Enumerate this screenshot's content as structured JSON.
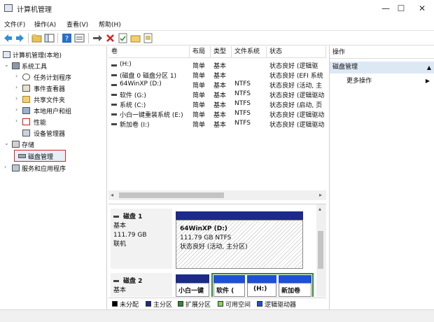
{
  "window": {
    "title": "计算机管理",
    "minimize_glyph": "—",
    "maximize_glyph": "☐",
    "close_glyph": "✕"
  },
  "menu": [
    "文件(F)",
    "操作(A)",
    "查看(V)",
    "帮助(H)"
  ],
  "tree": {
    "root": "计算机管理(本地)",
    "items": [
      {
        "label": "系统工具",
        "icon": "tools-icon"
      },
      {
        "label": "任务计划程序",
        "icon": "clock-icon"
      },
      {
        "label": "事件查看器",
        "icon": "event-viewer-icon"
      },
      {
        "label": "共享文件夹",
        "icon": "shared-folder-icon"
      },
      {
        "label": "本地用户和组",
        "icon": "users-icon"
      },
      {
        "label": "性能",
        "icon": "performance-icon"
      },
      {
        "label": "设备管理器",
        "icon": "device-manager-icon"
      },
      {
        "label": "存储",
        "icon": "storage-icon"
      },
      {
        "label": "磁盘管理",
        "icon": "disk-management-icon",
        "selected": true
      },
      {
        "label": "服务和应用程序",
        "icon": "services-icon"
      }
    ]
  },
  "volume_list": {
    "columns": [
      "卷",
      "布局",
      "类型",
      "文件系统",
      "状态"
    ],
    "rows": [
      {
        "volume": "(H:)",
        "layout": "简单",
        "type": "基本",
        "fs": "",
        "status": "状态良好 (逻辑驱"
      },
      {
        "volume": "(磁盘 0 磁盘分区 1)",
        "layout": "简单",
        "type": "基本",
        "fs": "",
        "status": "状态良好 (EFI 系统"
      },
      {
        "volume": "64WinXP  (D:)",
        "layout": "简单",
        "type": "基本",
        "fs": "NTFS",
        "status": "状态良好 (活动, 主"
      },
      {
        "volume": "软件 (G:)",
        "layout": "简单",
        "type": "基本",
        "fs": "NTFS",
        "status": "状态良好 (逻辑驱动"
      },
      {
        "volume": "系统 (C:)",
        "layout": "简单",
        "type": "基本",
        "fs": "NTFS",
        "status": "状态良好 (启动, 页"
      },
      {
        "volume": "小白一键重装系统 (E:)",
        "layout": "简单",
        "type": "基本",
        "fs": "NTFS",
        "status": "状态良好 (逻辑驱动"
      },
      {
        "volume": "新加卷 (I:)",
        "layout": "简单",
        "type": "基本",
        "fs": "NTFS",
        "status": "状态良好 (逻辑驱动"
      }
    ]
  },
  "disks": [
    {
      "name": "磁盘 1",
      "kind": "基本",
      "size": "111.79 GB",
      "state": "联机",
      "partition": {
        "name": "64WinXP   (D:)",
        "size": "111.79 GB NTFS",
        "status": "状态良好 (活动, 主分区)"
      }
    },
    {
      "name": "磁盘 2",
      "kind": "基本",
      "partitions": [
        "小白一键",
        "软件  (",
        "(H:)",
        "新加卷"
      ]
    }
  ],
  "legend": [
    {
      "label": "未分配",
      "color": "#000000"
    },
    {
      "label": "主分区",
      "color": "#1c2a8a"
    },
    {
      "label": "扩展分区",
      "color": "#2e8b2e"
    },
    {
      "label": "可用空间",
      "color": "#7cd850"
    },
    {
      "label": "逻辑驱动器",
      "color": "#1e4fd8"
    }
  ],
  "actions": {
    "header": "操作",
    "section": "磁盘管理",
    "more": "更多操作"
  },
  "colors": {
    "selected_outline": "#e02020",
    "primary_partition": "#1c2a8a",
    "logical_drive": "#1e4fd8",
    "extended_partition": "#2e8b2e"
  }
}
